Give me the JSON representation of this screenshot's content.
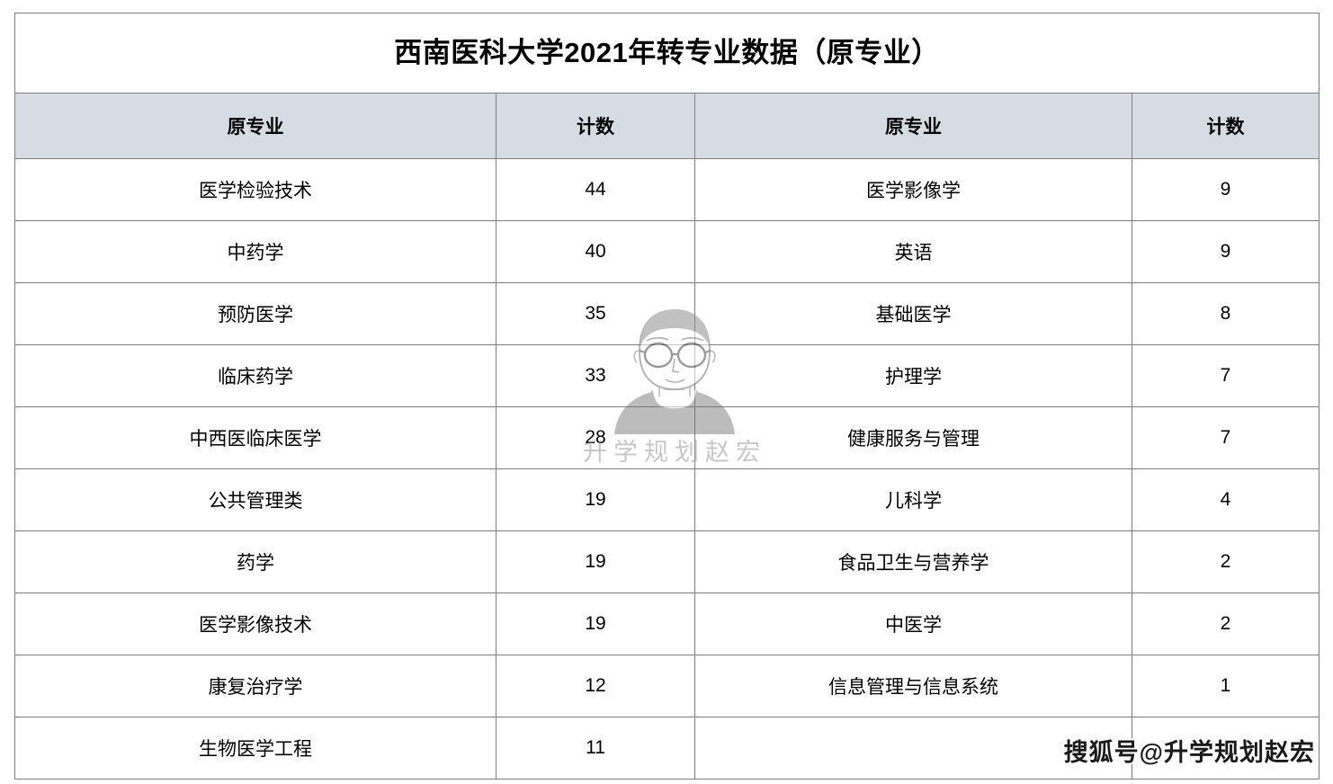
{
  "title": "西南医科大学2021年转专业数据（原专业）",
  "table": {
    "headers": {
      "major_left": "原专业",
      "count_left": "计数",
      "major_right": "原专业",
      "count_right": "计数"
    },
    "rows": [
      {
        "left_major": "医学检验技术",
        "left_count": "44",
        "left_red": false,
        "right_major": "医学影像学",
        "right_count": "9",
        "right_red": false
      },
      {
        "left_major": "中药学",
        "left_count": "40",
        "left_red": false,
        "right_major": "英语",
        "right_count": "9",
        "right_red": true
      },
      {
        "left_major": "预防医学",
        "left_count": "35",
        "left_red": false,
        "right_major": "基础医学",
        "right_count": "8",
        "right_red": false
      },
      {
        "left_major": "临床药学",
        "left_count": "33",
        "left_red": false,
        "right_major": "护理学",
        "right_count": "7",
        "right_red": true
      },
      {
        "left_major": "中西医临床医学",
        "left_count": "28",
        "left_red": false,
        "right_major": "健康服务与管理",
        "right_count": "7",
        "right_red": true
      },
      {
        "left_major": "公共管理类",
        "left_count": "19",
        "left_red": true,
        "right_major": "儿科学",
        "right_count": "4",
        "right_red": false
      },
      {
        "left_major": "药学",
        "left_count": "19",
        "left_red": false,
        "right_major": "食品卫生与营养学",
        "right_count": "2",
        "right_red": true
      },
      {
        "left_major": "医学影像技术",
        "left_count": "19",
        "left_red": false,
        "right_major": "中医学",
        "right_count": "2",
        "right_red": false
      },
      {
        "left_major": "康复治疗学",
        "left_count": "12",
        "left_red": false,
        "right_major": "信息管理与信息系统",
        "right_count": "1",
        "right_red": true
      },
      {
        "left_major": "生物医学工程",
        "left_count": "11",
        "left_red": false,
        "right_major": "",
        "right_count": "",
        "right_red": false
      }
    ]
  },
  "watermarks": {
    "center_text": "升学规划赵宏",
    "center_portrait": "portrait-sketch-icon",
    "corner_text": "搜狐号@升学规划赵宏"
  },
  "colors": {
    "header_fill": "#d6dce4",
    "border": "#7f7f7f",
    "highlight_text": "#ff0000",
    "body_text": "#000000"
  }
}
